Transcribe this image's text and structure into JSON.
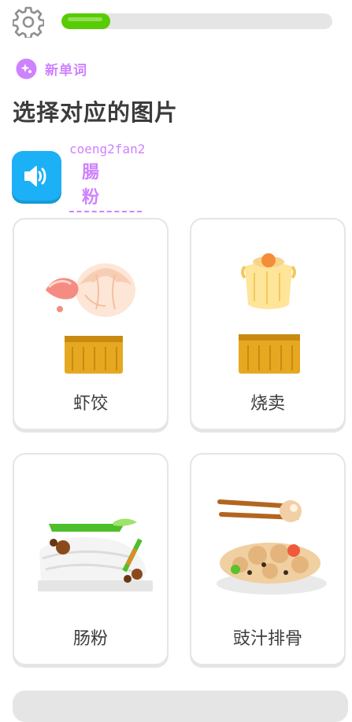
{
  "progress": {
    "value": 0.18,
    "fill_color": "#58cc02",
    "track_color": "#e5e5e5"
  },
  "settings": {
    "icon": "gear-icon"
  },
  "badge": {
    "label": "新单词",
    "icon": "sparkle-icon",
    "color": "#ce82ff"
  },
  "title": "选择对应的图片",
  "prompt": {
    "romanization": "coeng2fan2",
    "text": "腸 粉",
    "audio_icon": "speaker-icon",
    "button_color": "#1cb0f6"
  },
  "choices": [
    {
      "label": "虾饺",
      "image": "har-gow-image"
    },
    {
      "label": "烧卖",
      "image": "siu-mai-image"
    },
    {
      "label": "肠粉",
      "image": "rice-noodle-roll-image"
    },
    {
      "label": "豉汁排骨",
      "image": "black-bean-spare-ribs-image"
    }
  ]
}
